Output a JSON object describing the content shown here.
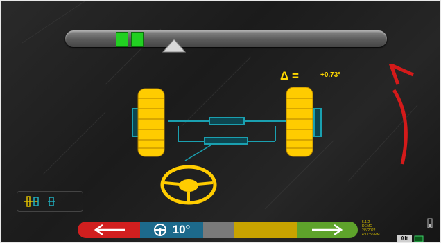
{
  "delta": {
    "symbol": "Δ =",
    "value": "+0.73°"
  },
  "steering": {
    "angle": "10°",
    "icon": "steering-wheel-icon"
  },
  "status": {
    "version": "5.1.2",
    "mode": "DEMO",
    "date": "2/5/2022",
    "time": "4:17:56 PM"
  },
  "alt_badge": "Alt",
  "colors": {
    "red": "#d11f1f",
    "blue": "#1d6a8c",
    "grey": "#7a7a7a",
    "yellow": "#c8a300",
    "green": "#5ea32b",
    "gauge_green": "#22d022",
    "tire": "#ffcc00",
    "arrow": "#d41a1a"
  }
}
